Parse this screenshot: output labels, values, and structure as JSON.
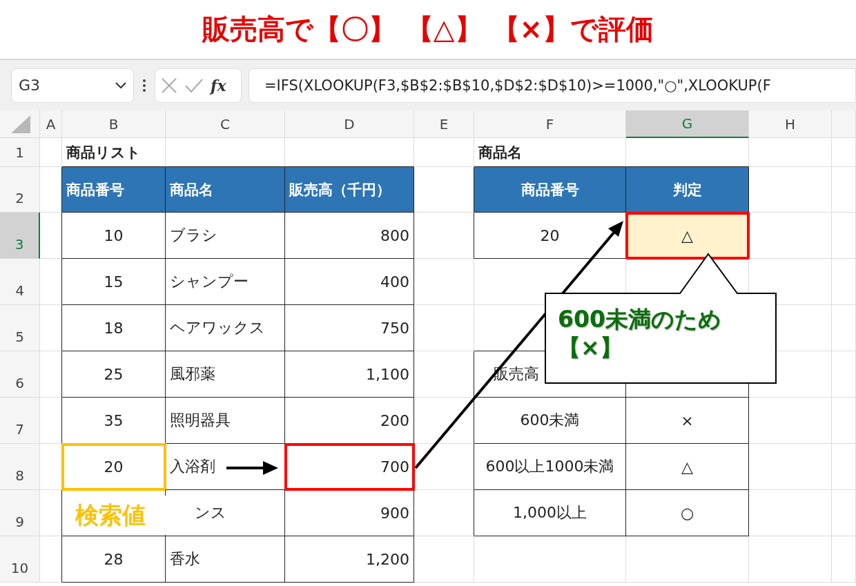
{
  "title": "販売高で【〇】 【△】 【×】で評価",
  "formula_bar": {
    "name_box": "G3",
    "function_label": "fx",
    "formula": "=IFS(XLOOKUP(F3,$B$2:$B$10,$D$2:$D$10)>=1000,\"○\",XLOOKUP(F"
  },
  "columns": [
    {
      "label": "A",
      "selected": false
    },
    {
      "label": "B",
      "selected": false
    },
    {
      "label": "C",
      "selected": false
    },
    {
      "label": "D",
      "selected": false
    },
    {
      "label": "E",
      "selected": false
    },
    {
      "label": "F",
      "selected": false
    },
    {
      "label": "G",
      "selected": true
    },
    {
      "label": "H",
      "selected": false
    }
  ],
  "rows": [
    {
      "label": "1",
      "selected": false
    },
    {
      "label": "2",
      "selected": false
    },
    {
      "label": "3",
      "selected": true
    },
    {
      "label": "4",
      "selected": false
    },
    {
      "label": "5",
      "selected": false
    },
    {
      "label": "6",
      "selected": false
    },
    {
      "label": "7",
      "selected": false
    },
    {
      "label": "8",
      "selected": false
    },
    {
      "label": "9",
      "selected": false
    },
    {
      "label": "10",
      "selected": false
    }
  ],
  "product_list": {
    "title": "商品リスト",
    "columns": [
      "商品番号",
      "商品名",
      "販売高（千円）"
    ],
    "rows": [
      {
        "number": "10",
        "name": "ブラシ",
        "sales": "800",
        "search_value": false,
        "match": false
      },
      {
        "number": "15",
        "name": "シャンプー",
        "sales": "400",
        "search_value": false,
        "match": false
      },
      {
        "number": "18",
        "name": "ヘアワックス",
        "sales": "750",
        "search_value": false,
        "match": false
      },
      {
        "number": "25",
        "name": "風邪薬",
        "sales": "1,100",
        "search_value": false,
        "match": false
      },
      {
        "number": "35",
        "name": "照明器具",
        "sales": "200",
        "search_value": false,
        "match": false
      },
      {
        "number": "20",
        "name": "入浴剤",
        "sales": "700",
        "search_value": true,
        "match": true
      },
      {
        "name": "ンス",
        "sales": "900",
        "search_value": false,
        "match": false
      },
      {
        "number": "28",
        "name": "香水",
        "sales": "1,200",
        "search_value": false,
        "match": false
      }
    ]
  },
  "lookup": {
    "title": "商品名",
    "columns": [
      "商品番号",
      "判定"
    ],
    "rows": [
      {
        "number": "20",
        "result": "△",
        "highlighted": true
      }
    ]
  },
  "criteria": {
    "columns": [
      "販売高"
    ],
    "rows": [
      {
        "range": "600未満",
        "mark": "×"
      },
      {
        "range": "600以上1000未満",
        "mark": "△"
      },
      {
        "range": "1,000以上",
        "mark": "○"
      }
    ]
  },
  "search_label": "検索値",
  "callout": [
    "600未満のため",
    "【×】"
  ]
}
